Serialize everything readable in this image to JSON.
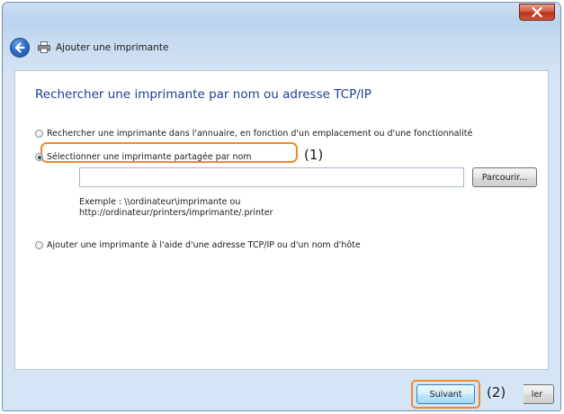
{
  "window": {
    "title": "Ajouter une imprimante",
    "close_icon": "close-icon",
    "back_icon": "back-arrow-icon",
    "printer_icon": "printer-icon"
  },
  "content": {
    "heading": "Rechercher une imprimante par nom ou adresse TCP/IP",
    "options": [
      {
        "label": "Rechercher une imprimante dans l'annuaire, en fonction d'un emplacement ou d'une fonctionnalité",
        "checked": false
      },
      {
        "label": "Sélectionner une imprimante partagée par nom",
        "checked": true
      },
      {
        "label": "Ajouter une imprimante à l'aide d'une adresse TCP/IP ou d'un nom d'hôte",
        "checked": false
      }
    ],
    "name_input": {
      "value": "",
      "placeholder": ""
    },
    "browse_button": "Parcourir...",
    "example_line1": "Exemple : \\\\ordinateur\\imprimante ou",
    "example_line2": "http://ordinateur/printers/imprimante/.printer"
  },
  "annotations": {
    "callout1": "(1)",
    "callout2": "(2)",
    "highlight_color": "#ef8a2c"
  },
  "footer": {
    "next_button": "Suivant",
    "cancel_button_visible": "ler"
  }
}
